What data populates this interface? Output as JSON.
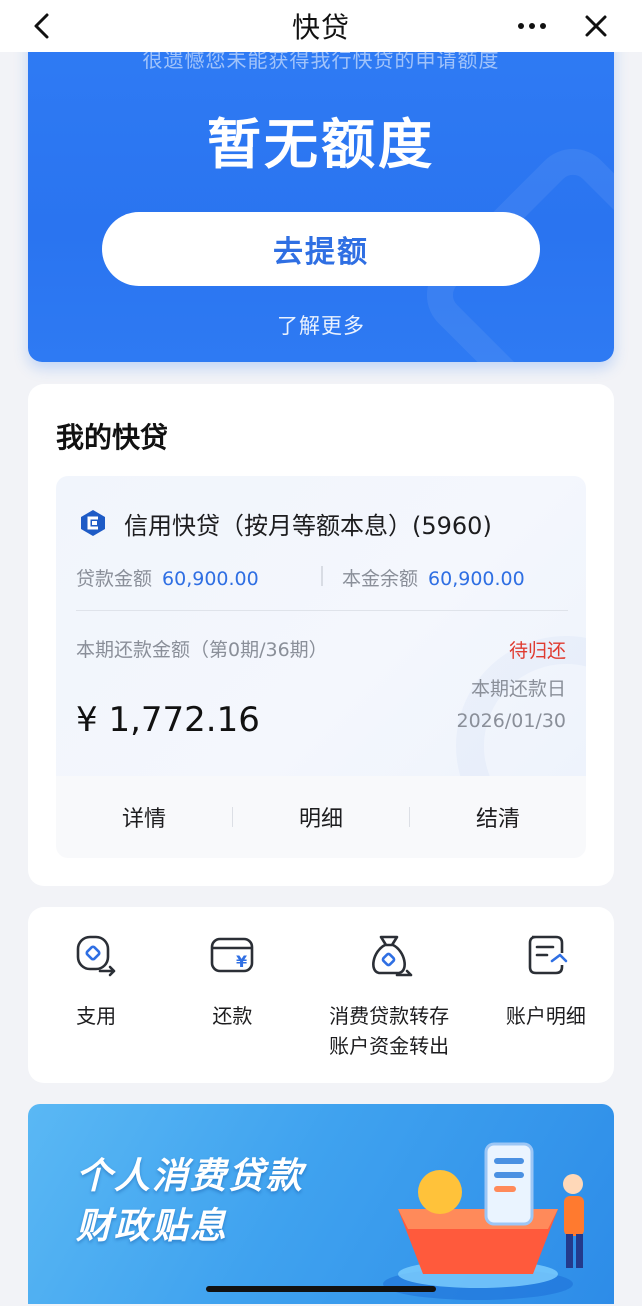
{
  "nav": {
    "title": "快贷",
    "back_icon": "chevron-left-icon",
    "more_icon": "more-icon",
    "close_icon": "close-icon"
  },
  "hero": {
    "subtitle": "很遗憾您未能获得我行快贷的申请额度",
    "amount_text": "暂无额度",
    "button_label": "去提额",
    "link_label": "了解更多"
  },
  "my_loan": {
    "title": "我的快贷",
    "product_name": "信用快贷（按月等额本息）(5960)",
    "loan_amount_label": "贷款金额",
    "loan_amount_value": "60,900.00",
    "principal_balance_label": "本金余额",
    "principal_balance_value": "60,900.00",
    "period_label": "本期还款金额（第0期/36期）",
    "period_amount": "¥ 1,772.16",
    "status": "待归还",
    "due_label": "本期还款日",
    "due_date": "2026/01/30",
    "actions": [
      "详情",
      "明细",
      "结清"
    ]
  },
  "services": [
    {
      "icon": "withdraw-icon",
      "label": "支用"
    },
    {
      "icon": "repay-icon",
      "label": "还款"
    },
    {
      "icon": "money-bag-icon",
      "label": "消费贷款转存\n账户资金转出"
    },
    {
      "icon": "account-detail-icon",
      "label": "账户明细"
    }
  ],
  "banner": {
    "title_line1": "个人消费贷款",
    "title_line2": "财政贴息"
  },
  "colors": {
    "brand_blue": "#2f7bf4",
    "link_blue": "#2f6fe3",
    "status_red": "#e03a2f"
  }
}
